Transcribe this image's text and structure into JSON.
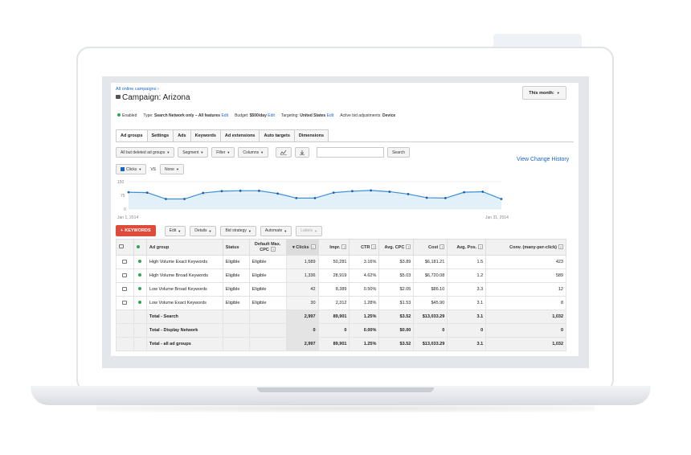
{
  "header": {
    "breadcrumb": "All online campaigns ›",
    "title_prefix": "Campaign:",
    "title_name": "Arizona",
    "date_range": "This month:"
  },
  "status_line": {
    "status": "Enabled",
    "type_label": "Type:",
    "type_value": "Search Network only – All features",
    "edit1": "Edit",
    "budget_label": "Budget:",
    "budget_value": "$500/day",
    "edit2": "Edit",
    "targeting_label": "Targeting:",
    "targeting_value": "United States",
    "edit3": "Edit",
    "bid_adj_label": "Active bid adjustments:",
    "bid_adj_value": "Device"
  },
  "tabs": [
    "Ad groups",
    "Settings",
    "Ads",
    "Keywords",
    "Ad extensions",
    "Auto targets",
    "Dimensions"
  ],
  "toolbar": {
    "filter_select": "All but deleted ad groups",
    "segment": "Segment",
    "filter": "Filter",
    "columns": "Columns",
    "chart_icon": "line-chart-icon",
    "download_icon": "download-icon",
    "search_button": "Search",
    "view_change_history": "View Change History"
  },
  "metrics": {
    "metric1": "Clicks",
    "vs": "VS",
    "metric2": "None"
  },
  "chart_data": {
    "type": "line",
    "x_start_label": "Jan 1, 2014",
    "x_end_label": "Jan 31, 2014",
    "ylim": [
      0,
      150
    ],
    "y_ticks": [
      "150",
      "75",
      "0"
    ],
    "series": [
      {
        "values": [
          92,
          90,
          55,
          55,
          88,
          98,
          100,
          100,
          85,
          60,
          60,
          90,
          98,
          102,
          95,
          82,
          62,
          60,
          92,
          95,
          55
        ]
      }
    ],
    "grid": true,
    "colors": {
      "line": "#3a8fd8",
      "fill": "#d6e9f8"
    }
  },
  "table_actions": {
    "add_keywords": "KEYWORDS",
    "edit": "Edit",
    "details": "Details",
    "bid_strategy": "Bid strategy",
    "automate": "Automate",
    "labels": "Labels"
  },
  "table": {
    "columns": {
      "ad_group": "Ad group",
      "status": "Status",
      "default_max_cpc": "Default Max. CPC",
      "clicks": "Clicks",
      "impr": "Impr.",
      "ctr": "CTR",
      "avg_cpc": "Avg. CPC",
      "cost": "Cost",
      "avg_pos": "Avg. Pos.",
      "conv": "Conv. (many-per-click)"
    },
    "rows": [
      {
        "name": "High Volume Exact Keywords",
        "status": "Eligible",
        "max_cpc": "Eligible",
        "clicks": "1,589",
        "impr": "50,281",
        "ctr": "3.16%",
        "avg_cpc": "$3.89",
        "cost": "$6,181.21",
        "avg_pos": "1.5",
        "conv": "423"
      },
      {
        "name": "High Volume Broad Keywords",
        "status": "Eligible",
        "max_cpc": "Eligible",
        "clicks": "1,336",
        "impr": "28,919",
        "ctr": "4.62%",
        "avg_cpc": "$5.03",
        "cost": "$6,720.08",
        "avg_pos": "1.2",
        "conv": "589"
      },
      {
        "name": "Low Volume Broad Keywords",
        "status": "Eligible",
        "max_cpc": "Eligible",
        "clicks": "42",
        "impr": "8,389",
        "ctr": "0.50%",
        "avg_cpc": "$2.05",
        "cost": "$86.10",
        "avg_pos": "3.3",
        "conv": "12"
      },
      {
        "name": "Low Volume Exact Keywords",
        "status": "Eligible",
        "max_cpc": "Eligible",
        "clicks": "30",
        "impr": "2,312",
        "ctr": "1.28%",
        "avg_cpc": "$1.53",
        "cost": "$45.90",
        "avg_pos": "3.1",
        "conv": "8"
      }
    ],
    "totals": [
      {
        "name": "Total - Search",
        "clicks": "2,997",
        "impr": "89,901",
        "ctr": "1.25%",
        "avg_cpc": "$3.52",
        "cost": "$13,033.29",
        "avg_pos": "3.1",
        "conv": "1,032"
      },
      {
        "name": "Total - Display Network",
        "clicks": "0",
        "impr": "0",
        "ctr": "0.00%",
        "avg_cpc": "$0.00",
        "cost": "0",
        "avg_pos": "0",
        "conv": "0"
      },
      {
        "name": "Total - all ad groups",
        "clicks": "2,997",
        "impr": "89,901",
        "ctr": "1.25%",
        "avg_cpc": "$3.52",
        "cost": "$13,033.29",
        "avg_pos": "3.1",
        "conv": "1,032"
      }
    ]
  }
}
